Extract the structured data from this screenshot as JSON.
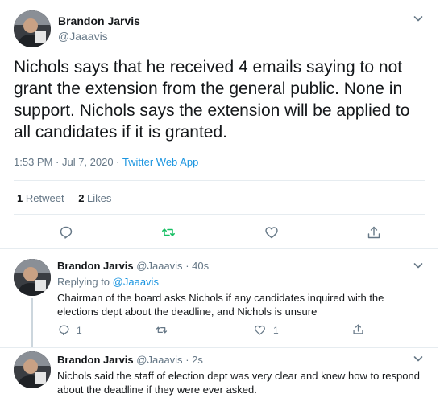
{
  "main_tweet": {
    "author_name": "Brandon Jarvis",
    "author_handle": "@Jaaavis",
    "text": "Nichols says that he received 4 emails saying to not grant the extension from the general public. None in support. Nichols says the extension will be applied to all candidates if it is granted.",
    "timestamp": "1:53 PM · Jul 7, 2020 · ",
    "source": "Twitter Web App",
    "retweets_count": "1",
    "retweets_label": "Retweet",
    "likes_count": "2",
    "likes_label": "Likes"
  },
  "replies": [
    {
      "author_name": "Brandon Jarvis",
      "author_handle": "@Jaaavis",
      "time": "· 40s",
      "replying_prefix": "Replying to",
      "replying_to": "@Jaaavis",
      "text": "Chairman of the board asks Nichols if any candidates inquired with the elections dept about the deadline, and Nichols is unsure",
      "reply_count": "1",
      "like_count": "1"
    },
    {
      "author_name": "Brandon Jarvis",
      "author_handle": "@Jaaavis",
      "time": "· 2s",
      "text": "Nichols said the staff of election dept was very clear and knew how to respond about the deadline if they were ever asked."
    }
  ],
  "colors": {
    "accent": "#1b95e0",
    "retweet_green": "#17bf63",
    "muted": "#657786",
    "text": "#14171a",
    "border": "#e6ecf0"
  },
  "icons": [
    "avatar-photo",
    "chevron-down-icon",
    "reply-icon",
    "retweet-icon",
    "like-icon",
    "share-icon"
  ]
}
